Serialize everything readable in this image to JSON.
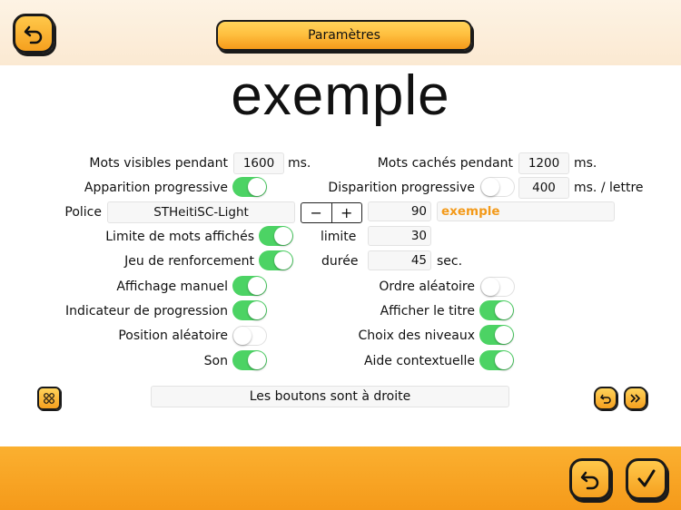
{
  "header": {
    "title": "Paramètres"
  },
  "sample_word": "exemple",
  "settings": {
    "visible_label": "Mots visibles pendant",
    "visible_value": "1600",
    "visible_unit": "ms.",
    "hidden_label": "Mots cachés pendant",
    "hidden_value": "1200",
    "hidden_unit": "ms.",
    "appear_label": "Apparition progressive",
    "disappear_label": "Disparition progressive",
    "disappear_value": "400",
    "disappear_unit": "ms. / lettre",
    "font_label": "Police",
    "font_value": "STHeitiSC-Light",
    "stepper_minus": "−",
    "stepper_plus": "+",
    "font_size": "90",
    "font_preview": "exemple",
    "limit_words_label": "Limite de mots affichés",
    "limit_label": "limite",
    "limit_value": "30",
    "reinforce_label": "Jeu de renforcement",
    "duration_label": "durée",
    "duration_value": "45",
    "duration_unit": "sec.",
    "manual_label": "Affichage manuel",
    "random_order_label": "Ordre aléatoire",
    "progress_label": "Indicateur de progression",
    "show_title_label": "Afficher le titre",
    "random_pos_label": "Position aléatoire",
    "levels_label": "Choix des niveaux",
    "sound_label": "Son",
    "help_label": "Aide contextuelle",
    "buttons_side": "Les boutons sont à droite"
  },
  "toggles": {
    "appear": true,
    "disappear": false,
    "limit_words": true,
    "reinforce": true,
    "manual": true,
    "random_order": false,
    "progress": true,
    "show_title": true,
    "random_pos": false,
    "levels": true,
    "sound": true,
    "help": true
  },
  "icons": {
    "back": "undo-arrow-icon",
    "honeycomb": "honeycomb-icon",
    "replay": "replay-icon",
    "fast_forward": "fast-forward-icon",
    "undo": "undo-icon",
    "confirm": "check-icon"
  },
  "colors": {
    "accent": "#f5a01f",
    "toggle_on": "#4cd364",
    "preview": "#f39a1a"
  }
}
